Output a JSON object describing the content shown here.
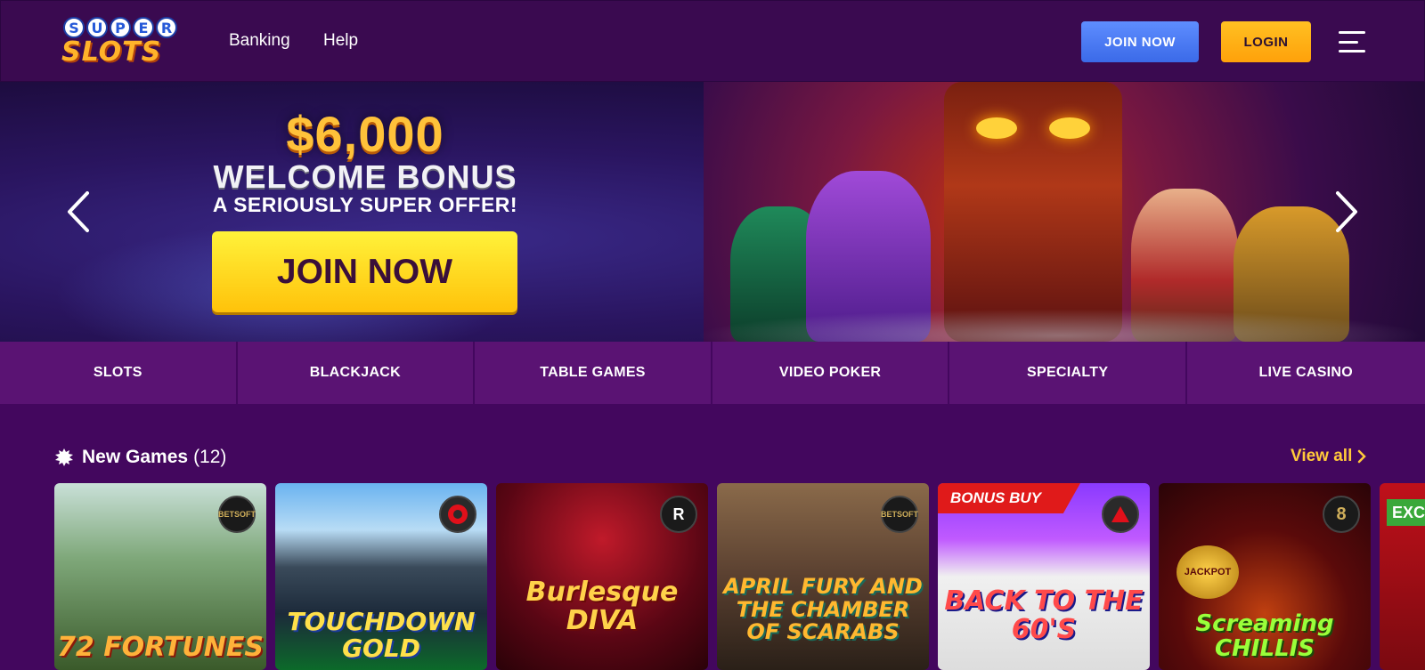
{
  "header": {
    "logo_top": "SUPER",
    "logo_bottom": "SLOTS",
    "nav": [
      {
        "label": "Banking"
      },
      {
        "label": "Help"
      }
    ],
    "join_label": "JOIN NOW",
    "login_label": "LOGIN"
  },
  "hero": {
    "amount": "$6,000",
    "title": "WELCOME BONUS",
    "subtitle": "A SERIOUSLY SUPER OFFER!",
    "cta": "JOIN NOW"
  },
  "categories": [
    {
      "label": "SLOTS"
    },
    {
      "label": "BLACKJACK"
    },
    {
      "label": "TABLE GAMES"
    },
    {
      "label": "VIDEO POKER"
    },
    {
      "label": "SPECIALTY"
    },
    {
      "label": "LIVE CASINO"
    }
  ],
  "new_games": {
    "title": "New Games",
    "count": "(12)",
    "view_all": "View all",
    "games": [
      {
        "title": "72 FORTUNES",
        "provider": "BETSOFT"
      },
      {
        "title": "TOUCHDOWN GOLD",
        "provider": ""
      },
      {
        "title": "Burlesque DIVA",
        "provider": "R"
      },
      {
        "title": "APRIL FURY AND THE CHAMBER OF SCARABS",
        "provider": "BETSOFT"
      },
      {
        "title": "BACK TO THE 60'S",
        "provider": "",
        "ribbon": "BONUS BUY"
      },
      {
        "title": "Screaming CHILLIS",
        "provider": "8",
        "jackpot": "JACKPOT"
      },
      {
        "title": "",
        "provider": "",
        "ribbon": "EXC"
      }
    ]
  },
  "colors": {
    "background": "#43075e",
    "header": "#3a0a50",
    "category_bar": "#5a1373",
    "join_button": "#4a7af0",
    "login_button": "#ffb018",
    "view_all": "#ffc93a"
  }
}
